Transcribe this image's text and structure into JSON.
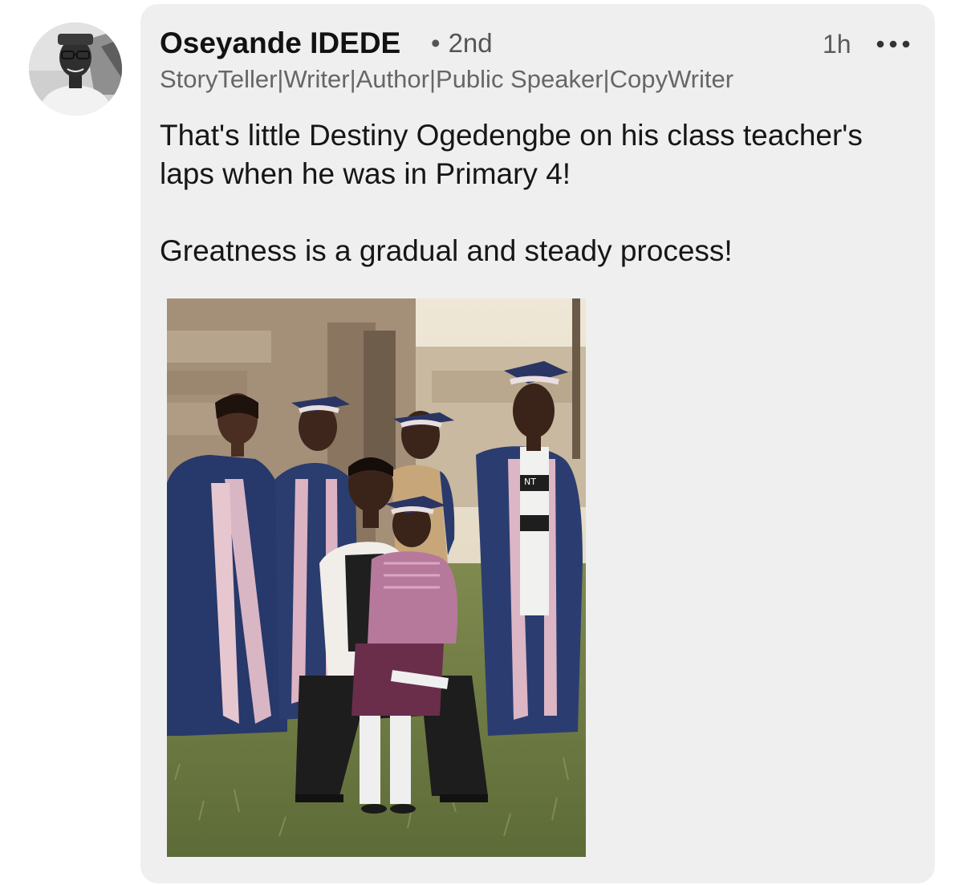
{
  "post": {
    "author": {
      "name": "Oseyande IDEDE",
      "degree_separator": "•",
      "degree": "2nd",
      "headline": "StoryTeller|Writer|Author|Public Speaker|CopyWriter",
      "avatar_icon": "profile-photo"
    },
    "time": "1h",
    "more_icon": "more-horizontal-icon",
    "text_paragraphs": [
      "That's little Destiny Ogedengbe on his class teacher's laps when he was in Primary 4!",
      "Greatness is a gradual and steady process!"
    ],
    "image": {
      "kind": "group-photo",
      "print_on_shirt": "NT"
    }
  },
  "colors": {
    "bubble_background": "#efefef",
    "page_background": "#ffffff",
    "name_text": "#121212",
    "meta_text": "#666666"
  }
}
